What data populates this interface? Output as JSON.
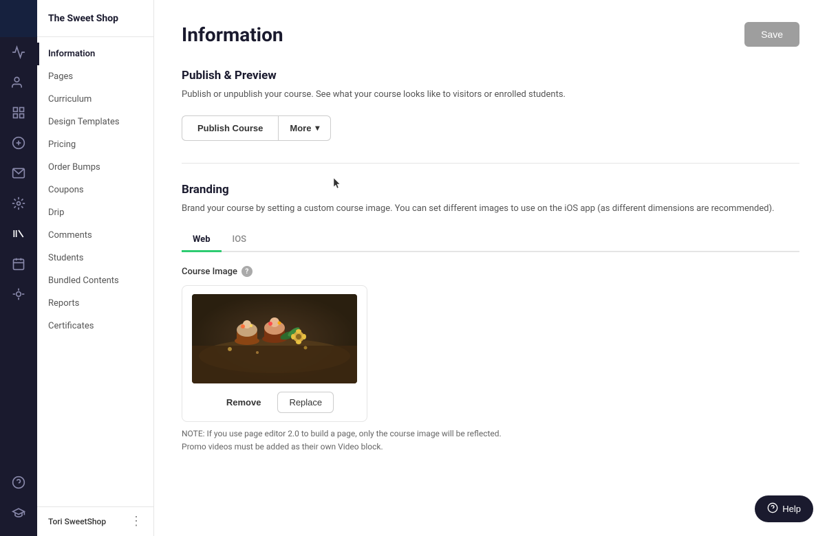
{
  "brand": {
    "name": "The Sweet Shop"
  },
  "icon_rail": {
    "icons": [
      {
        "name": "analytics-icon",
        "glyph": "📈",
        "active": false
      },
      {
        "name": "users-icon",
        "glyph": "👤",
        "active": false
      },
      {
        "name": "dashboard-icon",
        "glyph": "⊞",
        "active": false
      },
      {
        "name": "money-icon",
        "glyph": "💲",
        "active": false
      },
      {
        "name": "mail-icon",
        "glyph": "✉",
        "active": false
      },
      {
        "name": "settings-icon",
        "glyph": "⚙",
        "active": false
      },
      {
        "name": "library-icon",
        "glyph": "|||",
        "active": true
      },
      {
        "name": "calendar-icon",
        "glyph": "📅",
        "active": false
      },
      {
        "name": "apps-icon",
        "glyph": "⊕",
        "active": false
      }
    ],
    "bottom_icons": [
      {
        "name": "help-circle-icon",
        "glyph": "?"
      },
      {
        "name": "graduation-icon",
        "glyph": "🎓"
      }
    ]
  },
  "sidebar": {
    "items": [
      {
        "label": "Information",
        "active": true
      },
      {
        "label": "Pages",
        "active": false
      },
      {
        "label": "Curriculum",
        "active": false
      },
      {
        "label": "Design Templates",
        "active": false
      },
      {
        "label": "Pricing",
        "active": false
      },
      {
        "label": "Order Bumps",
        "active": false
      },
      {
        "label": "Coupons",
        "active": false
      },
      {
        "label": "Drip",
        "active": false
      },
      {
        "label": "Comments",
        "active": false
      },
      {
        "label": "Students",
        "active": false
      },
      {
        "label": "Bundled Contents",
        "active": false
      },
      {
        "label": "Reports",
        "active": false
      },
      {
        "label": "Certificates",
        "active": false
      }
    ],
    "footer": {
      "user_name": "Tori SweetShop"
    }
  },
  "main": {
    "title": "Information",
    "save_button": "Save",
    "sections": {
      "publish_preview": {
        "title": "Publish & Preview",
        "description": "Publish or unpublish your course. See what your course looks like to visitors or enrolled students.",
        "publish_btn": "Publish Course",
        "more_btn": "More"
      },
      "branding": {
        "title": "Branding",
        "description": "Brand your course by setting a custom course image. You can set different images to use on the iOS app (as different dimensions are recommended).",
        "tabs": [
          {
            "label": "Web",
            "active": true
          },
          {
            "label": "IOS",
            "active": false
          }
        ],
        "course_image_label": "Course Image",
        "remove_btn": "Remove",
        "replace_btn": "Replace",
        "note": "NOTE: If you use page editor 2.0 to build a page, only the course image will be reflected.\nPromo videos must be added as their own Video block."
      }
    }
  },
  "help_button": "Help"
}
